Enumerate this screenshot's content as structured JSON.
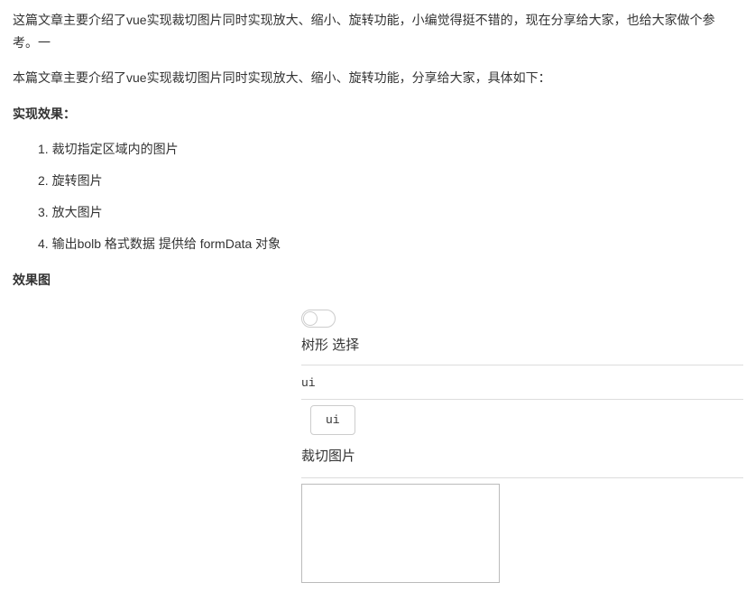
{
  "intro": "这篇文章主要介绍了vue实现裁切图片同时实现放大、缩小、旋转功能，小编觉得挺不错的，现在分享给大家，也给大家做个参考。一",
  "subtitle": "本篇文章主要介绍了vue实现裁切图片同时实现放大、缩小、旋转功能，分享给大家，具体如下：",
  "heading_effect": "实现效果：",
  "list_items": [
    "1. 裁切指定区域内的图片",
    "2. 旋转图片",
    "3. 放大图片",
    "4. 输出bolb 格式数据 提供给 formData 对象"
  ],
  "heading_result": "效果图",
  "demo": {
    "tree_label": "树形 选择",
    "input_value": "ui",
    "tag_value": "ui",
    "crop_label": "裁切图片"
  }
}
